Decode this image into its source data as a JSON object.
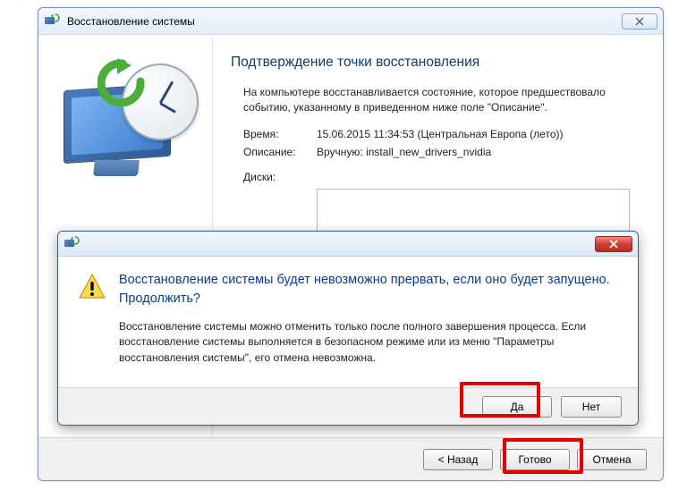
{
  "main": {
    "title": "Восстановление системы",
    "page_title": "Подтверждение точки восстановления",
    "intro": "На компьютере восстанавливается состояние, которое предшествовало событию, указанному в приведенном ниже поле \"Описание\".",
    "time_label": "Время:",
    "time_value": "15.06.2015 11:34:53 (Центральная Европа (лето))",
    "desc_label": "Описание:",
    "desc_value": "Вручную: install_new_drivers_nvidia",
    "disks_label": "Диски:",
    "back_label": "< Назад",
    "finish_label": "Готово",
    "cancel_label": "Отмена"
  },
  "dialog": {
    "heading": "Восстановление системы будет невозможно прервать, если оно будет запущено. Продолжить?",
    "body": "Восстановление системы можно отменить только после полного завершения процесса. Если восстановление системы выполняется в безопасном режиме или из меню \"Параметры восстановления системы\", его отмена невозможна.",
    "yes_label": "Да",
    "no_label": "Нет"
  }
}
